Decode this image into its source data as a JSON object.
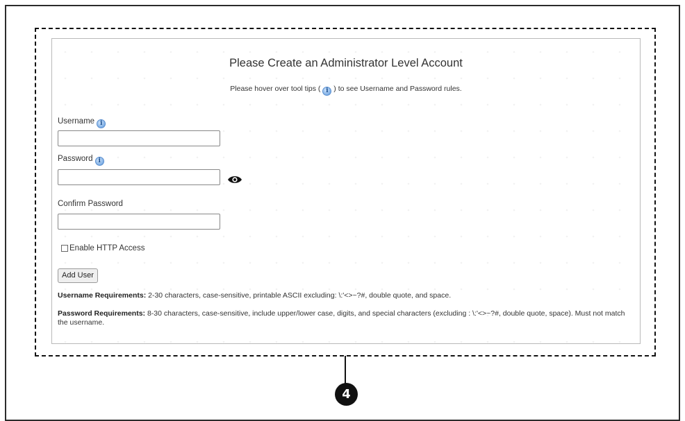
{
  "page": {
    "title": "Please Create an Administrator Level Account",
    "subtitle_before": "Please hover over tool tips (",
    "subtitle_after": ") to see Username and Password rules."
  },
  "form": {
    "username_label": "Username",
    "username_value": "",
    "password_label": "Password",
    "password_value": "",
    "confirm_password_label": "Confirm Password",
    "confirm_password_value": "",
    "enable_http_label": "Enable HTTP Access",
    "enable_http_checked": false,
    "add_user_label": "Add User"
  },
  "requirements": {
    "username_heading": "Username Requirements:",
    "username_text": " 2-30 characters, case-sensitive, printable ASCII excluding: \\:'<>~?#, double quote, and space.",
    "password_heading": "Password Requirements:",
    "password_text": " 8-30 characters, case-sensitive, include upper/lower case, digits, and special characters (excluding : \\:'<>~?#, double quote, space). Must not match the username."
  },
  "callout": {
    "number": "4"
  },
  "icons": {
    "info": "info-icon",
    "eye": "eye-icon"
  },
  "colors": {
    "callout": "#111111",
    "info_icon": "#7eaee5"
  }
}
